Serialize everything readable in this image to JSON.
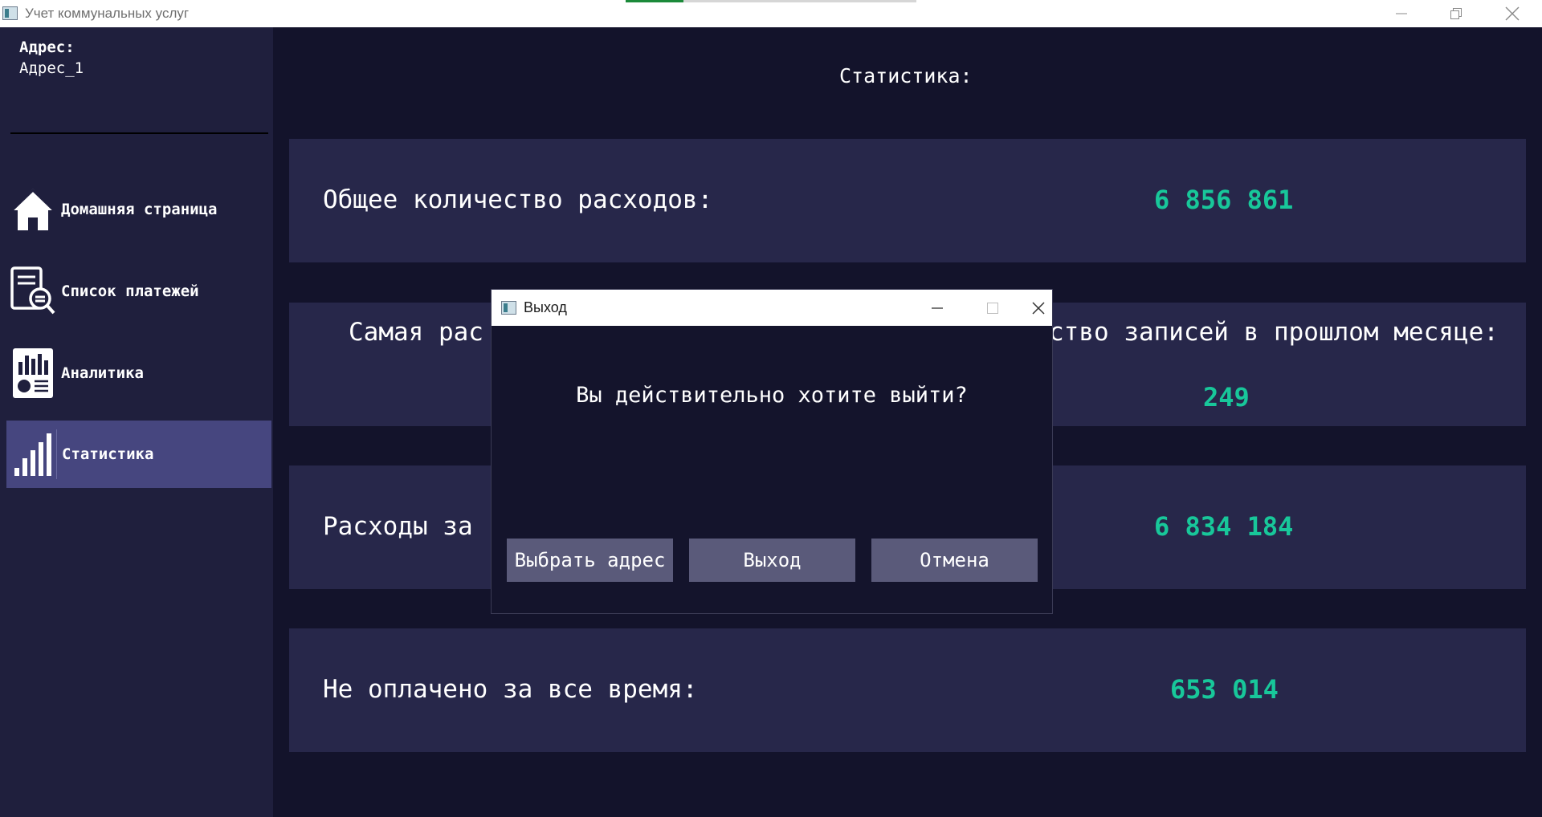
{
  "window": {
    "title": "Учет коммунальных услуг",
    "progress_fraction": 0.2
  },
  "sidebar": {
    "address_label": "Адрес:",
    "address_value": "Адрес_1",
    "items": [
      {
        "label": "Домашняя страница",
        "icon": "home-icon"
      },
      {
        "label": "Список платежей",
        "icon": "document-search-icon"
      },
      {
        "label": "Аналитика",
        "icon": "analytics-icon"
      },
      {
        "label": "Статистика",
        "icon": "bar-chart-icon",
        "active": true
      }
    ]
  },
  "main": {
    "title": "Статистика:",
    "cards": [
      {
        "label": "Общее количество расходов:",
        "value": "6 856 861"
      },
      {
        "label_left": "Самая рас",
        "label_right": "ство записей в прошлом месяце:",
        "value": "249"
      },
      {
        "label": "Расходы за ",
        "value": "6 834 184"
      },
      {
        "label": "Не оплачено за все время:",
        "value": "653 014"
      }
    ]
  },
  "dialog": {
    "title": "Выход",
    "message": "Вы действительно хотите выйти?",
    "buttons": {
      "choose_address": "Выбрать адрес",
      "exit": "Выход",
      "cancel": "Отмена"
    }
  },
  "colors": {
    "accent_value": "#18c79a",
    "active_nav": "#46467f",
    "button": "#5a5a7a"
  }
}
